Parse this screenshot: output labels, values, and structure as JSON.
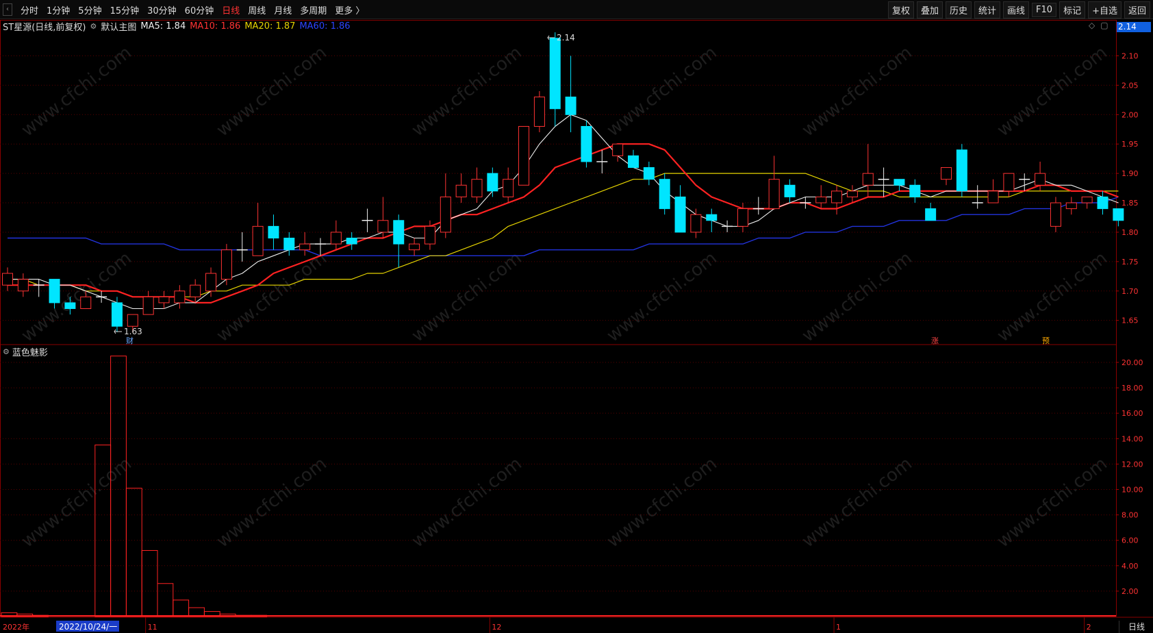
{
  "toolbar": {
    "periods": [
      "分时",
      "1分钟",
      "5分钟",
      "15分钟",
      "30分钟",
      "60分钟",
      "日线",
      "周线",
      "月线",
      "多周期",
      "更多 〉"
    ],
    "active_index": 6,
    "buttons": [
      "复权",
      "叠加",
      "历史",
      "统计",
      "画线",
      "F10",
      "标记",
      "+自选",
      "返回"
    ]
  },
  "header": {
    "stock": "ST星源(日线,前复权)",
    "main_chart_label": "默认主图",
    "ma5": "MA5: 1.84",
    "ma10": "MA10: 1.86",
    "ma20": "MA20: 1.87",
    "ma60": "MA60: 1.86",
    "price_tag": "2.14"
  },
  "indicator": {
    "name": "蓝色魅影"
  },
  "annotations": {
    "high": "2.14",
    "low": "1.63",
    "marker_cai": "财",
    "marker_zhang": "涨",
    "marker_yu": "预"
  },
  "bottom": {
    "year": "2022年",
    "cursor_date": "2022/10/24/一",
    "period": "日线"
  },
  "watermark": "www.cfchi.com",
  "colors": {
    "up": "#ff3333",
    "down": "#00e5ff",
    "ma5": "#eeeeee",
    "ma10": "#ff2222",
    "ma20": "#e6d400",
    "ma60": "#2233dd",
    "grid": "#5a0000",
    "hist": "#ff2222"
  },
  "chart_data": [
    {
      "type": "candlestick",
      "title": "ST星源(日线,前复权)",
      "ylim": [
        1.61,
        2.16
      ],
      "y_ticks": [
        1.65,
        1.7,
        1.75,
        1.8,
        1.85,
        1.9,
        1.95,
        2.0,
        2.05,
        2.1
      ],
      "x_labels": [
        {
          "index": 9,
          "label": "11"
        },
        {
          "index": 31,
          "label": "12"
        },
        {
          "index": 53,
          "label": "1"
        },
        {
          "index": 69,
          "label": "2"
        }
      ],
      "candles": [
        {
          "o": 1.71,
          "c": 1.73,
          "h": 1.74,
          "l": 1.7
        },
        {
          "o": 1.7,
          "c": 1.72,
          "h": 1.73,
          "l": 1.69
        },
        {
          "o": 1.71,
          "c": 1.71,
          "h": 1.72,
          "l": 1.69
        },
        {
          "o": 1.72,
          "c": 1.68,
          "h": 1.72,
          "l": 1.67
        },
        {
          "o": 1.68,
          "c": 1.67,
          "h": 1.69,
          "l": 1.66
        },
        {
          "o": 1.67,
          "c": 1.69,
          "h": 1.7,
          "l": 1.67
        },
        {
          "o": 1.69,
          "c": 1.69,
          "h": 1.7,
          "l": 1.68
        },
        {
          "o": 1.68,
          "c": 1.64,
          "h": 1.69,
          "l": 1.63
        },
        {
          "o": 1.64,
          "c": 1.66,
          "h": 1.66,
          "l": 1.63
        },
        {
          "o": 1.66,
          "c": 1.69,
          "h": 1.7,
          "l": 1.66
        },
        {
          "o": 1.68,
          "c": 1.69,
          "h": 1.7,
          "l": 1.67
        },
        {
          "o": 1.68,
          "c": 1.7,
          "h": 1.71,
          "l": 1.67
        },
        {
          "o": 1.69,
          "c": 1.71,
          "h": 1.72,
          "l": 1.68
        },
        {
          "o": 1.7,
          "c": 1.73,
          "h": 1.74,
          "l": 1.69
        },
        {
          "o": 1.72,
          "c": 1.77,
          "h": 1.78,
          "l": 1.71
        },
        {
          "o": 1.77,
          "c": 1.77,
          "h": 1.8,
          "l": 1.75
        },
        {
          "o": 1.76,
          "c": 1.81,
          "h": 1.85,
          "l": 1.76
        },
        {
          "o": 1.81,
          "c": 1.79,
          "h": 1.83,
          "l": 1.77
        },
        {
          "o": 1.79,
          "c": 1.77,
          "h": 1.8,
          "l": 1.76
        },
        {
          "o": 1.77,
          "c": 1.78,
          "h": 1.8,
          "l": 1.76
        },
        {
          "o": 1.78,
          "c": 1.78,
          "h": 1.79,
          "l": 1.76
        },
        {
          "o": 1.78,
          "c": 1.8,
          "h": 1.82,
          "l": 1.77
        },
        {
          "o": 1.79,
          "c": 1.78,
          "h": 1.8,
          "l": 1.77
        },
        {
          "o": 1.82,
          "c": 1.82,
          "h": 1.84,
          "l": 1.8
        },
        {
          "o": 1.8,
          "c": 1.82,
          "h": 1.86,
          "l": 1.79
        },
        {
          "o": 1.82,
          "c": 1.78,
          "h": 1.83,
          "l": 1.74
        },
        {
          "o": 1.77,
          "c": 1.78,
          "h": 1.79,
          "l": 1.76
        },
        {
          "o": 1.78,
          "c": 1.81,
          "h": 1.82,
          "l": 1.77
        },
        {
          "o": 1.8,
          "c": 1.86,
          "h": 1.9,
          "l": 1.79
        },
        {
          "o": 1.86,
          "c": 1.88,
          "h": 1.9,
          "l": 1.85
        },
        {
          "o": 1.86,
          "c": 1.89,
          "h": 1.91,
          "l": 1.85
        },
        {
          "o": 1.9,
          "c": 1.87,
          "h": 1.91,
          "l": 1.86
        },
        {
          "o": 1.86,
          "c": 1.89,
          "h": 1.91,
          "l": 1.85
        },
        {
          "o": 1.88,
          "c": 1.98,
          "h": 1.98,
          "l": 1.88
        },
        {
          "o": 1.98,
          "c": 2.03,
          "h": 2.04,
          "l": 1.97
        },
        {
          "o": 2.13,
          "c": 2.01,
          "h": 2.14,
          "l": 1.98
        },
        {
          "o": 2.03,
          "c": 2.0,
          "h": 2.1,
          "l": 1.97
        },
        {
          "o": 1.98,
          "c": 1.92,
          "h": 1.99,
          "l": 1.91
        },
        {
          "o": 1.92,
          "c": 1.92,
          "h": 1.94,
          "l": 1.9
        },
        {
          "o": 1.93,
          "c": 1.95,
          "h": 1.95,
          "l": 1.92
        },
        {
          "o": 1.93,
          "c": 1.91,
          "h": 1.94,
          "l": 1.91
        },
        {
          "o": 1.91,
          "c": 1.89,
          "h": 1.92,
          "l": 1.88
        },
        {
          "o": 1.89,
          "c": 1.84,
          "h": 1.9,
          "l": 1.83
        },
        {
          "o": 1.86,
          "c": 1.8,
          "h": 1.88,
          "l": 1.8
        },
        {
          "o": 1.8,
          "c": 1.83,
          "h": 1.84,
          "l": 1.79
        },
        {
          "o": 1.83,
          "c": 1.82,
          "h": 1.84,
          "l": 1.8
        },
        {
          "o": 1.81,
          "c": 1.81,
          "h": 1.82,
          "l": 1.8
        },
        {
          "o": 1.81,
          "c": 1.84,
          "h": 1.85,
          "l": 1.8
        },
        {
          "o": 1.84,
          "c": 1.84,
          "h": 1.86,
          "l": 1.83
        },
        {
          "o": 1.84,
          "c": 1.89,
          "h": 1.93,
          "l": 1.84
        },
        {
          "o": 1.88,
          "c": 1.86,
          "h": 1.89,
          "l": 1.85
        },
        {
          "o": 1.85,
          "c": 1.85,
          "h": 1.86,
          "l": 1.84
        },
        {
          "o": 1.85,
          "c": 1.86,
          "h": 1.88,
          "l": 1.84
        },
        {
          "o": 1.85,
          "c": 1.87,
          "h": 1.88,
          "l": 1.83
        },
        {
          "o": 1.86,
          "c": 1.87,
          "h": 1.88,
          "l": 1.85
        },
        {
          "o": 1.88,
          "c": 1.9,
          "h": 1.95,
          "l": 1.86
        },
        {
          "o": 1.89,
          "c": 1.89,
          "h": 1.91,
          "l": 1.86
        },
        {
          "o": 1.89,
          "c": 1.88,
          "h": 1.89,
          "l": 1.87
        },
        {
          "o": 1.88,
          "c": 1.86,
          "h": 1.89,
          "l": 1.85
        },
        {
          "o": 1.84,
          "c": 1.82,
          "h": 1.85,
          "l": 1.82
        },
        {
          "o": 1.89,
          "c": 1.91,
          "h": 1.91,
          "l": 1.88
        },
        {
          "o": 1.94,
          "c": 1.87,
          "h": 1.95,
          "l": 1.86
        },
        {
          "o": 1.85,
          "c": 1.85,
          "h": 1.88,
          "l": 1.84
        },
        {
          "o": 1.85,
          "c": 1.87,
          "h": 1.89,
          "l": 1.85
        },
        {
          "o": 1.87,
          "c": 1.9,
          "h": 1.9,
          "l": 1.86
        },
        {
          "o": 1.89,
          "c": 1.89,
          "h": 1.9,
          "l": 1.87
        },
        {
          "o": 1.88,
          "c": 1.9,
          "h": 1.92,
          "l": 1.87
        },
        {
          "o": 1.81,
          "c": 1.85,
          "h": 1.86,
          "l": 1.8
        },
        {
          "o": 1.84,
          "c": 1.85,
          "h": 1.86,
          "l": 1.83
        },
        {
          "o": 1.85,
          "c": 1.86,
          "h": 1.86,
          "l": 1.84
        },
        {
          "o": 1.86,
          "c": 1.84,
          "h": 1.87,
          "l": 1.83
        },
        {
          "o": 1.84,
          "c": 1.82,
          "h": 1.84,
          "l": 1.81
        }
      ],
      "ma5": [
        1.72,
        1.72,
        1.72,
        1.71,
        1.71,
        1.7,
        1.69,
        1.68,
        1.67,
        1.67,
        1.67,
        1.68,
        1.68,
        1.7,
        1.72,
        1.73,
        1.75,
        1.76,
        1.77,
        1.78,
        1.78,
        1.78,
        1.79,
        1.79,
        1.8,
        1.8,
        1.79,
        1.79,
        1.82,
        1.83,
        1.84,
        1.87,
        1.88,
        1.91,
        1.95,
        1.98,
        2.0,
        1.99,
        1.96,
        1.93,
        1.91,
        1.9,
        1.87,
        1.85,
        1.83,
        1.82,
        1.81,
        1.81,
        1.82,
        1.84,
        1.85,
        1.86,
        1.86,
        1.86,
        1.87,
        1.88,
        1.88,
        1.88,
        1.87,
        1.86,
        1.87,
        1.87,
        1.87,
        1.87,
        1.87,
        1.88,
        1.89,
        1.88,
        1.88,
        1.87,
        1.86,
        1.85
      ],
      "ma10": [
        1.71,
        1.71,
        1.71,
        1.71,
        1.71,
        1.71,
        1.7,
        1.7,
        1.69,
        1.69,
        1.69,
        1.69,
        1.68,
        1.68,
        1.69,
        1.7,
        1.71,
        1.73,
        1.74,
        1.75,
        1.76,
        1.77,
        1.78,
        1.79,
        1.79,
        1.8,
        1.81,
        1.81,
        1.82,
        1.83,
        1.83,
        1.84,
        1.85,
        1.86,
        1.88,
        1.91,
        1.92,
        1.93,
        1.94,
        1.95,
        1.95,
        1.95,
        1.94,
        1.91,
        1.88,
        1.86,
        1.85,
        1.84,
        1.84,
        1.84,
        1.85,
        1.85,
        1.84,
        1.84,
        1.85,
        1.86,
        1.86,
        1.87,
        1.87,
        1.87,
        1.87,
        1.87,
        1.87,
        1.87,
        1.87,
        1.87,
        1.88,
        1.88,
        1.87,
        1.87,
        1.87,
        1.86
      ],
      "ma20": [
        1.72,
        1.72,
        1.71,
        1.71,
        1.71,
        1.7,
        1.7,
        1.7,
        1.69,
        1.69,
        1.69,
        1.69,
        1.69,
        1.7,
        1.7,
        1.71,
        1.71,
        1.71,
        1.71,
        1.72,
        1.72,
        1.72,
        1.72,
        1.73,
        1.73,
        1.74,
        1.75,
        1.76,
        1.76,
        1.77,
        1.78,
        1.79,
        1.81,
        1.82,
        1.83,
        1.84,
        1.85,
        1.86,
        1.87,
        1.88,
        1.89,
        1.89,
        1.9,
        1.9,
        1.9,
        1.9,
        1.9,
        1.9,
        1.9,
        1.9,
        1.9,
        1.9,
        1.89,
        1.88,
        1.87,
        1.87,
        1.87,
        1.86,
        1.86,
        1.86,
        1.86,
        1.86,
        1.86,
        1.86,
        1.86,
        1.87,
        1.87,
        1.87,
        1.87,
        1.87,
        1.87,
        1.87
      ],
      "ma60": [
        1.79,
        1.79,
        1.79,
        1.79,
        1.79,
        1.79,
        1.78,
        1.78,
        1.78,
        1.78,
        1.78,
        1.77,
        1.77,
        1.77,
        1.77,
        1.77,
        1.77,
        1.77,
        1.77,
        1.77,
        1.76,
        1.76,
        1.76,
        1.76,
        1.76,
        1.76,
        1.76,
        1.76,
        1.76,
        1.76,
        1.76,
        1.76,
        1.76,
        1.76,
        1.77,
        1.77,
        1.77,
        1.77,
        1.77,
        1.77,
        1.77,
        1.78,
        1.78,
        1.78,
        1.78,
        1.78,
        1.78,
        1.78,
        1.79,
        1.79,
        1.79,
        1.8,
        1.8,
        1.8,
        1.81,
        1.81,
        1.81,
        1.82,
        1.82,
        1.82,
        1.82,
        1.83,
        1.83,
        1.83,
        1.83,
        1.84,
        1.84,
        1.84,
        1.85,
        1.85,
        1.85,
        1.86
      ]
    },
    {
      "type": "bar",
      "title": "蓝色魅影",
      "ylim": [
        0,
        21.4
      ],
      "y_ticks": [
        2,
        4,
        6,
        8,
        10,
        12,
        14,
        16,
        18,
        20
      ],
      "values": [
        0.3,
        0.2,
        0.1,
        0,
        0,
        0,
        13.5,
        20.5,
        10.1,
        5.2,
        2.6,
        1.3,
        0.7,
        0.4,
        0.2,
        0.1,
        0.1,
        0,
        0,
        0,
        0
      ]
    }
  ]
}
